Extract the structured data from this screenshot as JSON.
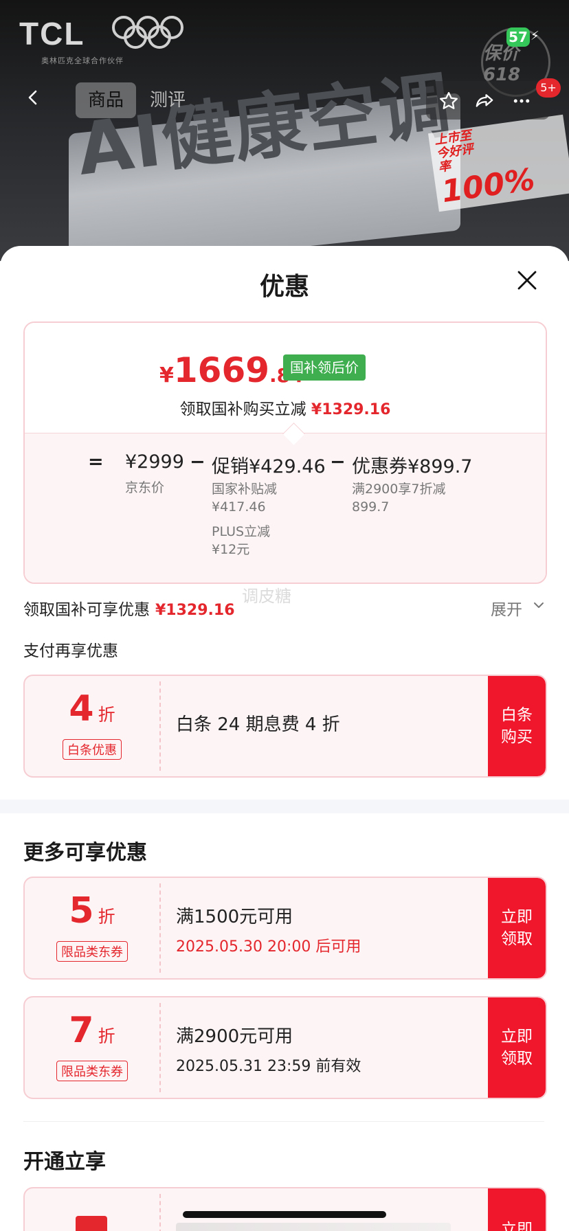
{
  "status_bar": {
    "battery": "57"
  },
  "hero": {
    "brand": "TCL",
    "brand_subtitle": "奥林匹克全球合作伙伴",
    "headline": "AI健康空调",
    "promo_badge": "保价618",
    "rating_prefix": "上市至今好评率",
    "rating_value": "100%"
  },
  "nav": {
    "tabs": [
      {
        "label": "商品"
      },
      {
        "label": "测评"
      }
    ],
    "cart_badge": "5+"
  },
  "sheet": {
    "title": "优惠",
    "price": {
      "currency": "¥",
      "integer": "1669",
      "decimal": ".84",
      "tag": "国补领后价",
      "gov_text": "领取国补购买立减",
      "gov_amount": "¥1329.16"
    },
    "formula": {
      "eq": "=",
      "jd_price": "¥2999",
      "jd_label": "京东价",
      "minus1": "−",
      "promo": "促销¥429.46",
      "promo_sub1_a": "国家补贴减",
      "promo_sub1_b": "¥417.46",
      "promo_sub2_a": "PLUS立减",
      "promo_sub2_b": "¥12元",
      "minus2": "−",
      "coupon": "优惠券¥899.7",
      "coupon_sub_a": "满2900享7折减",
      "coupon_sub_b": "899.7"
    },
    "claim_row": {
      "text": "领取国补可享优惠",
      "amount": "¥1329.16",
      "expand": "展开"
    },
    "watermark": "调皮糖",
    "pay_section_title": "支付再享优惠",
    "baitiao": {
      "discount": "4",
      "unit": "折",
      "label": "白条优惠",
      "desc": "白条 24 期息费 4 折",
      "button": "白条\n购买"
    },
    "more_title": "更多可享优惠",
    "coupons": [
      {
        "discount": "5",
        "unit": "折",
        "label": "限品类东券",
        "condition": "满1500元可用",
        "validity": "2025.05.30 20:00 后可用",
        "validity_color": "#e4262d",
        "button": "立即\n领取"
      },
      {
        "discount": "7",
        "unit": "折",
        "label": "限品类东券",
        "condition": "满2900元可用",
        "validity": "2025.05.31 23:59 前有效",
        "validity_color": "#222222",
        "button": "立即\n领取"
      }
    ],
    "open_title": "开通立享",
    "open_button": "立即"
  },
  "colors": {
    "accent": "#e4262d",
    "button": "#f0162c",
    "tag_green": "#3fae4f"
  }
}
